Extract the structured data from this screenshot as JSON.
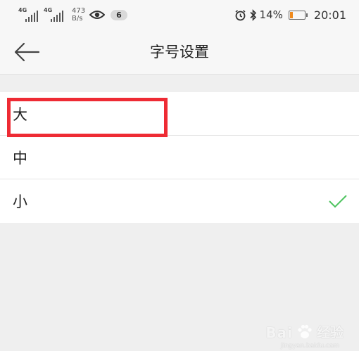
{
  "status_bar": {
    "network1": "4G",
    "network2": "4G",
    "speed_value": "473",
    "speed_unit": "B/s",
    "notification_count": "6",
    "battery": "14%",
    "time": "20:01"
  },
  "header": {
    "title": "字号设置"
  },
  "font_sizes": [
    {
      "label": "大",
      "selected": false
    },
    {
      "label": "中",
      "selected": false
    },
    {
      "label": "小",
      "selected": true
    }
  ],
  "watermark": {
    "brand": "Bai",
    "brand_suffix": "经验",
    "url": "jingyan.baidu.com"
  },
  "colors": {
    "highlight": "#ee2b34",
    "check": "#4cc35e",
    "battery_low": "#f08a1c"
  }
}
